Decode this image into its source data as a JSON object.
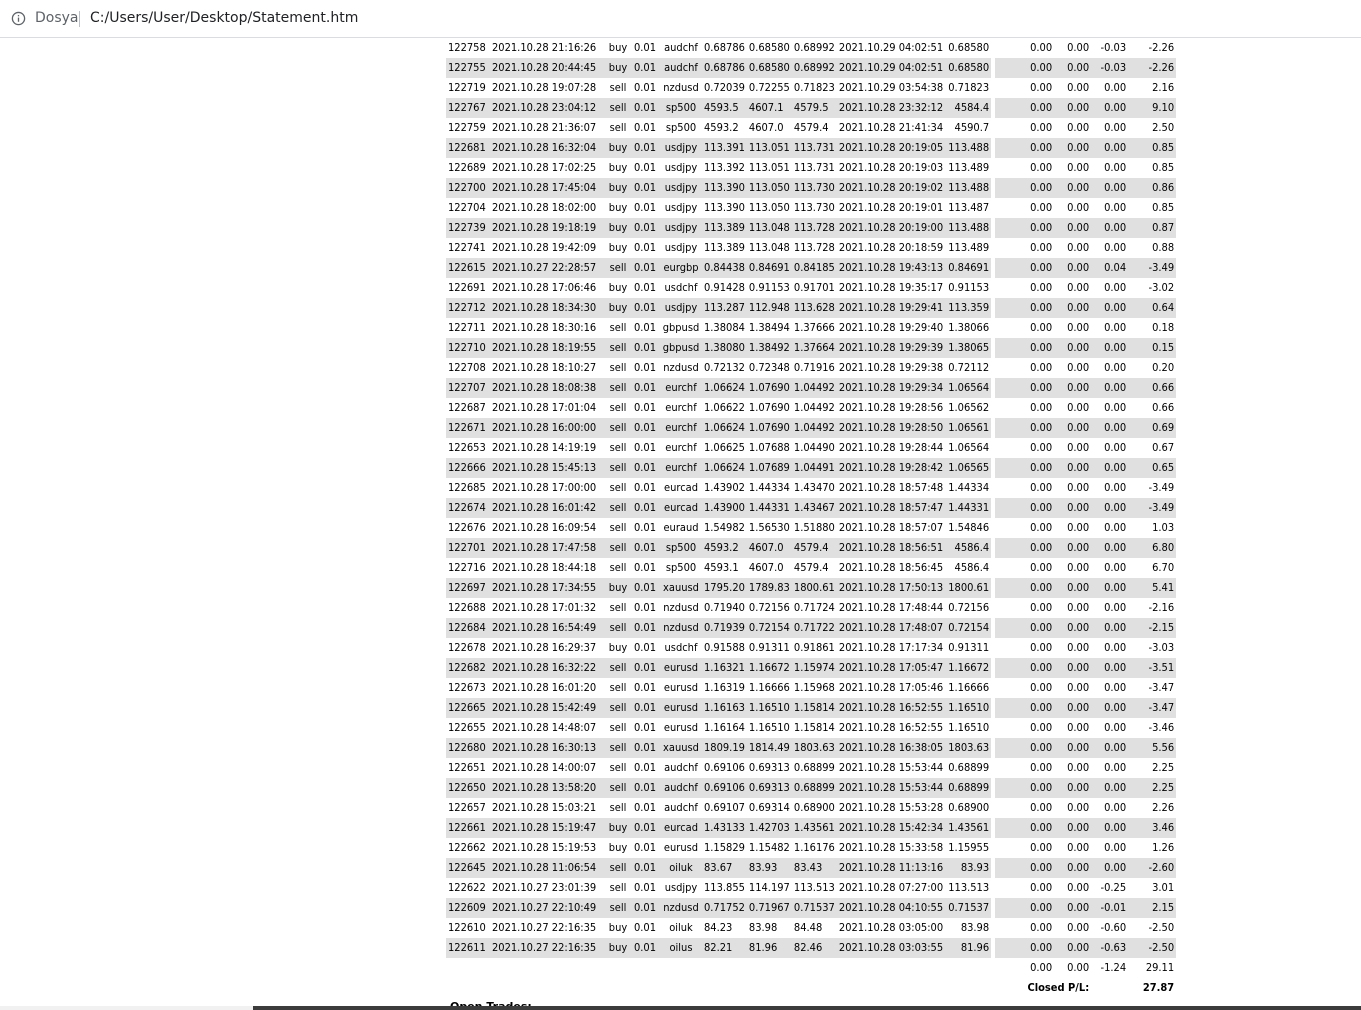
{
  "address_bar": {
    "scheme_label": "Dosya",
    "path": "C:/Users/User/Desktop/Statement.htm",
    "icon": "info-icon"
  },
  "statement": {
    "rows": [
      [
        "122758",
        "2021.10.28 21:16:26",
        "buy",
        "0.01",
        "audchf",
        "0.68786",
        "0.68580",
        "0.68992",
        "2021.10.29 04:02:51",
        "0.68580",
        "0.00",
        "0.00",
        "-0.03",
        "-2.26"
      ],
      [
        "122755",
        "2021.10.28 20:44:45",
        "buy",
        "0.01",
        "audchf",
        "0.68786",
        "0.68580",
        "0.68992",
        "2021.10.29 04:02:51",
        "0.68580",
        "0.00",
        "0.00",
        "-0.03",
        "-2.26"
      ],
      [
        "122719",
        "2021.10.28 19:07:28",
        "sell",
        "0.01",
        "nzdusd",
        "0.72039",
        "0.72255",
        "0.71823",
        "2021.10.29 03:54:38",
        "0.71823",
        "0.00",
        "0.00",
        "0.00",
        "2.16"
      ],
      [
        "122767",
        "2021.10.28 23:04:12",
        "sell",
        "0.01",
        "sp500",
        "4593.5",
        "4607.1",
        "4579.5",
        "2021.10.28 23:32:12",
        "4584.4",
        "0.00",
        "0.00",
        "0.00",
        "9.10"
      ],
      [
        "122759",
        "2021.10.28 21:36:07",
        "sell",
        "0.01",
        "sp500",
        "4593.2",
        "4607.0",
        "4579.4",
        "2021.10.28 21:41:34",
        "4590.7",
        "0.00",
        "0.00",
        "0.00",
        "2.50"
      ],
      [
        "122681",
        "2021.10.28 16:32:04",
        "buy",
        "0.01",
        "usdjpy",
        "113.391",
        "113.051",
        "113.731",
        "2021.10.28 20:19:05",
        "113.488",
        "0.00",
        "0.00",
        "0.00",
        "0.85"
      ],
      [
        "122689",
        "2021.10.28 17:02:25",
        "buy",
        "0.01",
        "usdjpy",
        "113.392",
        "113.051",
        "113.731",
        "2021.10.28 20:19:03",
        "113.489",
        "0.00",
        "0.00",
        "0.00",
        "0.85"
      ],
      [
        "122700",
        "2021.10.28 17:45:04",
        "buy",
        "0.01",
        "usdjpy",
        "113.390",
        "113.050",
        "113.730",
        "2021.10.28 20:19:02",
        "113.488",
        "0.00",
        "0.00",
        "0.00",
        "0.86"
      ],
      [
        "122704",
        "2021.10.28 18:02:00",
        "buy",
        "0.01",
        "usdjpy",
        "113.390",
        "113.050",
        "113.730",
        "2021.10.28 20:19:01",
        "113.487",
        "0.00",
        "0.00",
        "0.00",
        "0.85"
      ],
      [
        "122739",
        "2021.10.28 19:18:19",
        "buy",
        "0.01",
        "usdjpy",
        "113.389",
        "113.048",
        "113.728",
        "2021.10.28 20:19:00",
        "113.488",
        "0.00",
        "0.00",
        "0.00",
        "0.87"
      ],
      [
        "122741",
        "2021.10.28 19:42:09",
        "buy",
        "0.01",
        "usdjpy",
        "113.389",
        "113.048",
        "113.728",
        "2021.10.28 20:18:59",
        "113.489",
        "0.00",
        "0.00",
        "0.00",
        "0.88"
      ],
      [
        "122615",
        "2021.10.27 22:28:57",
        "sell",
        "0.01",
        "eurgbp",
        "0.84438",
        "0.84691",
        "0.84185",
        "2021.10.28 19:43:13",
        "0.84691",
        "0.00",
        "0.00",
        "0.04",
        "-3.49"
      ],
      [
        "122691",
        "2021.10.28 17:06:46",
        "buy",
        "0.01",
        "usdchf",
        "0.91428",
        "0.91153",
        "0.91701",
        "2021.10.28 19:35:17",
        "0.91153",
        "0.00",
        "0.00",
        "0.00",
        "-3.02"
      ],
      [
        "122712",
        "2021.10.28 18:34:30",
        "buy",
        "0.01",
        "usdjpy",
        "113.287",
        "112.948",
        "113.628",
        "2021.10.28 19:29:41",
        "113.359",
        "0.00",
        "0.00",
        "0.00",
        "0.64"
      ],
      [
        "122711",
        "2021.10.28 18:30:16",
        "sell",
        "0.01",
        "gbpusd",
        "1.38084",
        "1.38494",
        "1.37666",
        "2021.10.28 19:29:40",
        "1.38066",
        "0.00",
        "0.00",
        "0.00",
        "0.18"
      ],
      [
        "122710",
        "2021.10.28 18:19:55",
        "sell",
        "0.01",
        "gbpusd",
        "1.38080",
        "1.38492",
        "1.37664",
        "2021.10.28 19:29:39",
        "1.38065",
        "0.00",
        "0.00",
        "0.00",
        "0.15"
      ],
      [
        "122708",
        "2021.10.28 18:10:27",
        "sell",
        "0.01",
        "nzdusd",
        "0.72132",
        "0.72348",
        "0.71916",
        "2021.10.28 19:29:38",
        "0.72112",
        "0.00",
        "0.00",
        "0.00",
        "0.20"
      ],
      [
        "122707",
        "2021.10.28 18:08:38",
        "sell",
        "0.01",
        "eurchf",
        "1.06624",
        "1.07690",
        "1.04492",
        "2021.10.28 19:29:34",
        "1.06564",
        "0.00",
        "0.00",
        "0.00",
        "0.66"
      ],
      [
        "122687",
        "2021.10.28 17:01:04",
        "sell",
        "0.01",
        "eurchf",
        "1.06622",
        "1.07690",
        "1.04492",
        "2021.10.28 19:28:56",
        "1.06562",
        "0.00",
        "0.00",
        "0.00",
        "0.66"
      ],
      [
        "122671",
        "2021.10.28 16:00:00",
        "sell",
        "0.01",
        "eurchf",
        "1.06624",
        "1.07690",
        "1.04492",
        "2021.10.28 19:28:50",
        "1.06561",
        "0.00",
        "0.00",
        "0.00",
        "0.69"
      ],
      [
        "122653",
        "2021.10.28 14:19:19",
        "sell",
        "0.01",
        "eurchf",
        "1.06625",
        "1.07688",
        "1.04490",
        "2021.10.28 19:28:44",
        "1.06564",
        "0.00",
        "0.00",
        "0.00",
        "0.67"
      ],
      [
        "122666",
        "2021.10.28 15:45:13",
        "sell",
        "0.01",
        "eurchf",
        "1.06624",
        "1.07689",
        "1.04491",
        "2021.10.28 19:28:42",
        "1.06565",
        "0.00",
        "0.00",
        "0.00",
        "0.65"
      ],
      [
        "122685",
        "2021.10.28 17:00:00",
        "sell",
        "0.01",
        "eurcad",
        "1.43902",
        "1.44334",
        "1.43470",
        "2021.10.28 18:57:48",
        "1.44334",
        "0.00",
        "0.00",
        "0.00",
        "-3.49"
      ],
      [
        "122674",
        "2021.10.28 16:01:42",
        "sell",
        "0.01",
        "eurcad",
        "1.43900",
        "1.44331",
        "1.43467",
        "2021.10.28 18:57:47",
        "1.44331",
        "0.00",
        "0.00",
        "0.00",
        "-3.49"
      ],
      [
        "122676",
        "2021.10.28 16:09:54",
        "sell",
        "0.01",
        "euraud",
        "1.54982",
        "1.56530",
        "1.51880",
        "2021.10.28 18:57:07",
        "1.54846",
        "0.00",
        "0.00",
        "0.00",
        "1.03"
      ],
      [
        "122701",
        "2021.10.28 17:47:58",
        "sell",
        "0.01",
        "sp500",
        "4593.2",
        "4607.0",
        "4579.4",
        "2021.10.28 18:56:51",
        "4586.4",
        "0.00",
        "0.00",
        "0.00",
        "6.80"
      ],
      [
        "122716",
        "2021.10.28 18:44:18",
        "sell",
        "0.01",
        "sp500",
        "4593.1",
        "4607.0",
        "4579.4",
        "2021.10.28 18:56:45",
        "4586.4",
        "0.00",
        "0.00",
        "0.00",
        "6.70"
      ],
      [
        "122697",
        "2021.10.28 17:34:55",
        "buy",
        "0.01",
        "xauusd",
        "1795.20",
        "1789.83",
        "1800.61",
        "2021.10.28 17:50:13",
        "1800.61",
        "0.00",
        "0.00",
        "0.00",
        "5.41"
      ],
      [
        "122688",
        "2021.10.28 17:01:32",
        "sell",
        "0.01",
        "nzdusd",
        "0.71940",
        "0.72156",
        "0.71724",
        "2021.10.28 17:48:44",
        "0.72156",
        "0.00",
        "0.00",
        "0.00",
        "-2.16"
      ],
      [
        "122684",
        "2021.10.28 16:54:49",
        "sell",
        "0.01",
        "nzdusd",
        "0.71939",
        "0.72154",
        "0.71722",
        "2021.10.28 17:48:07",
        "0.72154",
        "0.00",
        "0.00",
        "0.00",
        "-2.15"
      ],
      [
        "122678",
        "2021.10.28 16:29:37",
        "buy",
        "0.01",
        "usdchf",
        "0.91588",
        "0.91311",
        "0.91861",
        "2021.10.28 17:17:34",
        "0.91311",
        "0.00",
        "0.00",
        "0.00",
        "-3.03"
      ],
      [
        "122682",
        "2021.10.28 16:32:22",
        "sell",
        "0.01",
        "eurusd",
        "1.16321",
        "1.16672",
        "1.15974",
        "2021.10.28 17:05:47",
        "1.16672",
        "0.00",
        "0.00",
        "0.00",
        "-3.51"
      ],
      [
        "122673",
        "2021.10.28 16:01:20",
        "sell",
        "0.01",
        "eurusd",
        "1.16319",
        "1.16666",
        "1.15968",
        "2021.10.28 17:05:46",
        "1.16666",
        "0.00",
        "0.00",
        "0.00",
        "-3.47"
      ],
      [
        "122665",
        "2021.10.28 15:42:49",
        "sell",
        "0.01",
        "eurusd",
        "1.16163",
        "1.16510",
        "1.15814",
        "2021.10.28 16:52:55",
        "1.16510",
        "0.00",
        "0.00",
        "0.00",
        "-3.47"
      ],
      [
        "122655",
        "2021.10.28 14:48:07",
        "sell",
        "0.01",
        "eurusd",
        "1.16164",
        "1.16510",
        "1.15814",
        "2021.10.28 16:52:55",
        "1.16510",
        "0.00",
        "0.00",
        "0.00",
        "-3.46"
      ],
      [
        "122680",
        "2021.10.28 16:30:13",
        "sell",
        "0.01",
        "xauusd",
        "1809.19",
        "1814.49",
        "1803.63",
        "2021.10.28 16:38:05",
        "1803.63",
        "0.00",
        "0.00",
        "0.00",
        "5.56"
      ],
      [
        "122651",
        "2021.10.28 14:00:07",
        "sell",
        "0.01",
        "audchf",
        "0.69106",
        "0.69313",
        "0.68899",
        "2021.10.28 15:53:44",
        "0.68899",
        "0.00",
        "0.00",
        "0.00",
        "2.25"
      ],
      [
        "122650",
        "2021.10.28 13:58:20",
        "sell",
        "0.01",
        "audchf",
        "0.69106",
        "0.69313",
        "0.68899",
        "2021.10.28 15:53:44",
        "0.68899",
        "0.00",
        "0.00",
        "0.00",
        "2.25"
      ],
      [
        "122657",
        "2021.10.28 15:03:21",
        "sell",
        "0.01",
        "audchf",
        "0.69107",
        "0.69314",
        "0.68900",
        "2021.10.28 15:53:28",
        "0.68900",
        "0.00",
        "0.00",
        "0.00",
        "2.26"
      ],
      [
        "122661",
        "2021.10.28 15:19:47",
        "buy",
        "0.01",
        "eurcad",
        "1.43133",
        "1.42703",
        "1.43561",
        "2021.10.28 15:42:34",
        "1.43561",
        "0.00",
        "0.00",
        "0.00",
        "3.46"
      ],
      [
        "122662",
        "2021.10.28 15:19:53",
        "buy",
        "0.01",
        "eurusd",
        "1.15829",
        "1.15482",
        "1.16176",
        "2021.10.28 15:33:58",
        "1.15955",
        "0.00",
        "0.00",
        "0.00",
        "1.26"
      ],
      [
        "122645",
        "2021.10.28 11:06:54",
        "sell",
        "0.01",
        "oiluk",
        "83.67",
        "83.93",
        "83.43",
        "2021.10.28 11:13:16",
        "83.93",
        "0.00",
        "0.00",
        "0.00",
        "-2.60"
      ],
      [
        "122622",
        "2021.10.27 23:01:39",
        "sell",
        "0.01",
        "usdjpy",
        "113.855",
        "114.197",
        "113.513",
        "2021.10.28 07:27:00",
        "113.513",
        "0.00",
        "0.00",
        "-0.25",
        "3.01"
      ],
      [
        "122609",
        "2021.10.27 22:10:49",
        "sell",
        "0.01",
        "nzdusd",
        "0.71752",
        "0.71967",
        "0.71537",
        "2021.10.28 04:10:55",
        "0.71537",
        "0.00",
        "0.00",
        "-0.01",
        "2.15"
      ],
      [
        "122610",
        "2021.10.27 22:16:35",
        "buy",
        "0.01",
        "oiluk",
        "84.23",
        "83.98",
        "84.48",
        "2021.10.28 03:05:00",
        "83.98",
        "0.00",
        "0.00",
        "-0.60",
        "-2.50"
      ],
      [
        "122611",
        "2021.10.27 22:16:35",
        "buy",
        "0.01",
        "oilus",
        "82.21",
        "81.96",
        "82.46",
        "2021.10.28 03:03:55",
        "81.96",
        "0.00",
        "0.00",
        "-0.63",
        "-2.50"
      ]
    ],
    "totals": [
      "0.00",
      "0.00",
      "-1.24",
      "29.11"
    ],
    "closed_pl_label": "Closed P/L:",
    "closed_pl_value": "27.87"
  },
  "next_section_peek": "Open Trades:"
}
